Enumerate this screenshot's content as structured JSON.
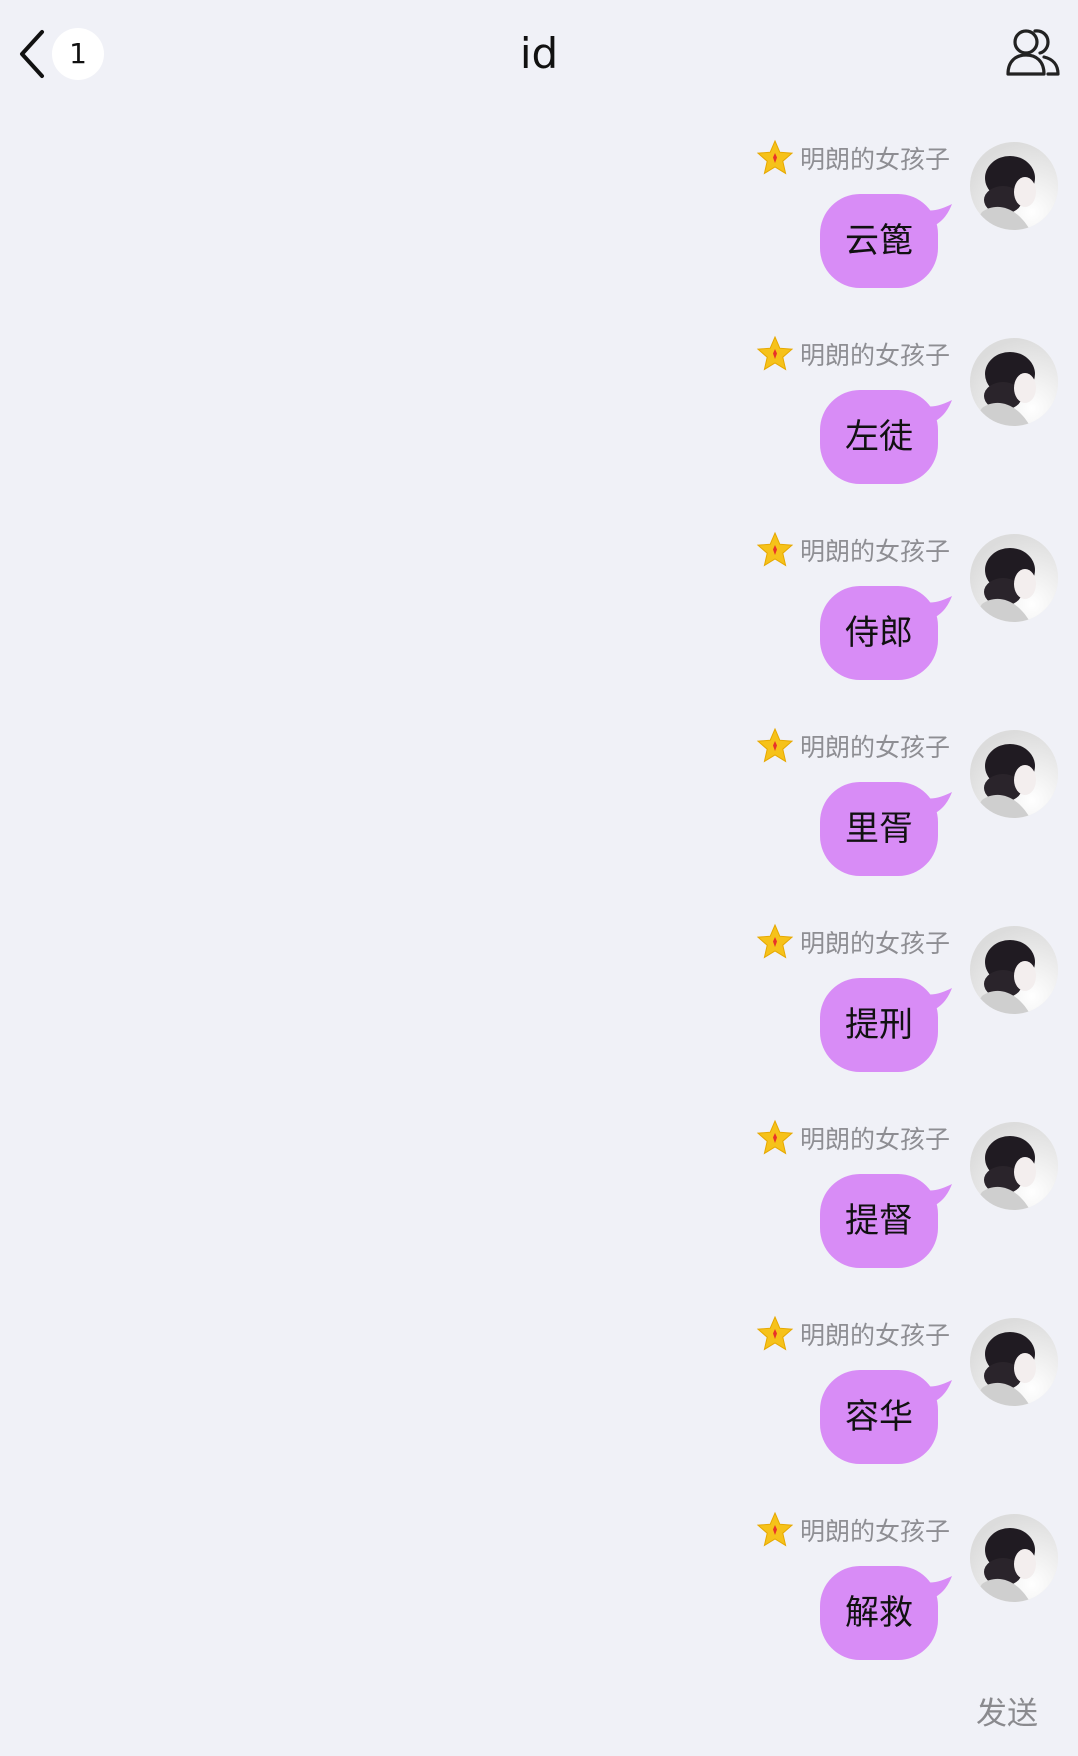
{
  "header": {
    "back_badge": "1",
    "title": "id"
  },
  "messages": [
    {
      "sender": "明朗的女孩子",
      "text": "云篦"
    },
    {
      "sender": "明朗的女孩子",
      "text": "左徒"
    },
    {
      "sender": "明朗的女孩子",
      "text": "侍郎"
    },
    {
      "sender": "明朗的女孩子",
      "text": "里胥"
    },
    {
      "sender": "明朗的女孩子",
      "text": "提刑"
    },
    {
      "sender": "明朗的女孩子",
      "text": "提督"
    },
    {
      "sender": "明朗的女孩子",
      "text": "容华"
    },
    {
      "sender": "明朗的女孩子",
      "text": "解救"
    }
  ],
  "footer": {
    "send_label": "发送"
  },
  "colors": {
    "background": "#f0f1f7",
    "bubble": "#d88cf6",
    "nickname": "#8e8e93",
    "star": "#f6c21a"
  },
  "icons": {
    "back": "chevron-left-icon",
    "group": "group-members-icon",
    "badge": "star-badge-icon"
  }
}
